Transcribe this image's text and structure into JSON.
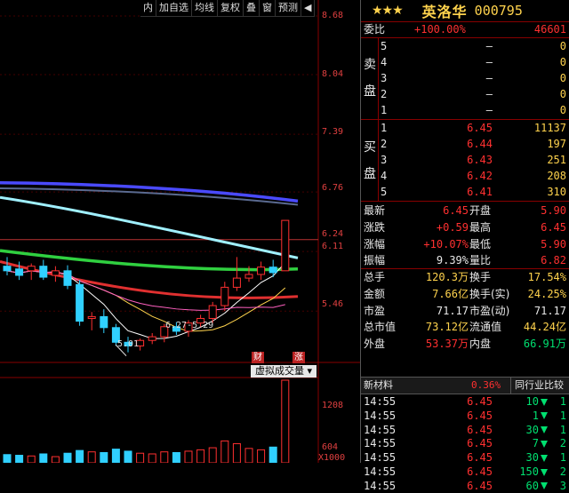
{
  "toolbar": {
    "items": [
      "内",
      "加自选",
      "均线",
      "复权",
      "叠",
      "窗",
      "预测",
      "◀"
    ]
  },
  "price_axis": {
    "ticks": [
      "8.68",
      "8.04",
      "7.39",
      "6.76",
      "6.24",
      "6.11",
      "5.46"
    ]
  },
  "volume_axis": {
    "ticks": [
      "1208",
      "604",
      "X1000"
    ]
  },
  "annotations": {
    "low": "5.01",
    "range": "6.27-5.29"
  },
  "badges": {
    "cai": "财",
    "zhang": "涨"
  },
  "volume_panel": {
    "label": "虚拟成交量"
  },
  "stock": {
    "stars": "★★★",
    "name": "英洛华",
    "code": "000795"
  },
  "weibi": {
    "label": "委比",
    "pct": "+100.00%",
    "diff": "46601"
  },
  "sell": {
    "label_top": "卖",
    "label_bottom": "盘",
    "levels": [
      {
        "n": "5",
        "p": "–",
        "v": "0"
      },
      {
        "n": "4",
        "p": "–",
        "v": "0"
      },
      {
        "n": "3",
        "p": "–",
        "v": "0"
      },
      {
        "n": "2",
        "p": "–",
        "v": "0"
      },
      {
        "n": "1",
        "p": "–",
        "v": "0"
      }
    ]
  },
  "buy": {
    "label_top": "买",
    "label_bottom": "盘",
    "levels": [
      {
        "n": "1",
        "p": "6.45",
        "v": "11137"
      },
      {
        "n": "2",
        "p": "6.44",
        "v": "197"
      },
      {
        "n": "3",
        "p": "6.43",
        "v": "251"
      },
      {
        "n": "4",
        "p": "6.42",
        "v": "208"
      },
      {
        "n": "5",
        "p": "6.41",
        "v": "310"
      }
    ]
  },
  "quote": [
    {
      "l1": "最新",
      "v1": "6.45",
      "l2": "开盘",
      "v2": "5.90",
      "c1": "red",
      "c2": "red"
    },
    {
      "l1": "涨跌",
      "v1": "+0.59",
      "l2": "最高",
      "v2": "6.45",
      "c1": "red",
      "c2": "red"
    },
    {
      "l1": "涨幅",
      "v1": "+10.07%",
      "l2": "最低",
      "v2": "5.90",
      "c1": "red",
      "c2": "red"
    },
    {
      "l1": "振幅",
      "v1": "9.39%",
      "l2": "量比",
      "v2": "6.82",
      "c1": "wht",
      "c2": "red"
    }
  ],
  "stats": [
    {
      "l1": "总手",
      "v1": "120.3万",
      "l2": "换手",
      "v2": "17.54%",
      "c1": "yel",
      "c2": "yel"
    },
    {
      "l1": "金额",
      "v1": "7.66亿",
      "l2": "换手(实)",
      "v2": "24.25%",
      "c1": "yel",
      "c2": "yel"
    },
    {
      "l1": "市盈",
      "v1": "71.17",
      "l2": "市盈(动)",
      "v2": "71.17",
      "c1": "wht",
      "c2": "wht"
    },
    {
      "l1": "总市值",
      "v1": "73.12亿",
      "l2": "流通值",
      "v2": "44.24亿",
      "c1": "yel",
      "c2": "yel"
    },
    {
      "l1": "外盘",
      "v1": "53.37万",
      "l2": "内盘",
      "v2": "66.91万",
      "c1": "red",
      "c2": "grn"
    }
  ],
  "sector": {
    "name": "新材料",
    "pct": "0.36%",
    "compare": "同行业比较"
  },
  "ticks": [
    {
      "t": "14:55",
      "p": "6.45",
      "v": "10",
      "n": "1"
    },
    {
      "t": "14:55",
      "p": "6.45",
      "v": "1",
      "n": "1"
    },
    {
      "t": "14:55",
      "p": "6.45",
      "v": "30",
      "n": "1"
    },
    {
      "t": "14:55",
      "p": "6.45",
      "v": "7",
      "n": "2"
    },
    {
      "t": "14:55",
      "p": "6.45",
      "v": "30",
      "n": "1"
    },
    {
      "t": "14:55",
      "p": "6.45",
      "v": "150",
      "n": "2"
    },
    {
      "t": "14:55",
      "p": "6.45",
      "v": "60",
      "n": "3"
    }
  ],
  "colors": {
    "up": "#ff3030",
    "down": "#00e070",
    "gold": "#ffd34d",
    "grid": "#800000"
  },
  "chart_data": {
    "type": "candlestick",
    "ylim": [
      4.9,
      8.68
    ],
    "candles": [
      {
        "o": 5.95,
        "h": 6.05,
        "l": 5.85,
        "c": 5.9
      },
      {
        "o": 5.92,
        "h": 6.0,
        "l": 5.8,
        "c": 5.85
      },
      {
        "o": 5.9,
        "h": 5.98,
        "l": 5.8,
        "c": 5.95
      },
      {
        "o": 5.95,
        "h": 6.02,
        "l": 5.8,
        "c": 5.83
      },
      {
        "o": 5.85,
        "h": 5.95,
        "l": 5.78,
        "c": 5.9
      },
      {
        "o": 5.9,
        "h": 5.96,
        "l": 5.7,
        "c": 5.74
      },
      {
        "o": 5.75,
        "h": 5.8,
        "l": 5.3,
        "c": 5.35
      },
      {
        "o": 5.38,
        "h": 5.45,
        "l": 5.25,
        "c": 5.4
      },
      {
        "o": 5.4,
        "h": 5.48,
        "l": 5.22,
        "c": 5.28
      },
      {
        "o": 5.28,
        "h": 5.32,
        "l": 5.08,
        "c": 5.12
      },
      {
        "o": 5.12,
        "h": 5.18,
        "l": 5.01,
        "c": 5.08
      },
      {
        "o": 5.08,
        "h": 5.16,
        "l": 5.03,
        "c": 5.14
      },
      {
        "o": 5.14,
        "h": 5.22,
        "l": 5.1,
        "c": 5.18
      },
      {
        "o": 5.18,
        "h": 5.32,
        "l": 5.12,
        "c": 5.29
      },
      {
        "o": 5.29,
        "h": 5.34,
        "l": 5.2,
        "c": 5.24
      },
      {
        "o": 5.24,
        "h": 5.36,
        "l": 5.18,
        "c": 5.33
      },
      {
        "o": 5.33,
        "h": 5.42,
        "l": 5.28,
        "c": 5.38
      },
      {
        "o": 5.38,
        "h": 5.56,
        "l": 5.33,
        "c": 5.52
      },
      {
        "o": 5.52,
        "h": 5.78,
        "l": 5.46,
        "c": 5.72
      },
      {
        "o": 5.72,
        "h": 6.05,
        "l": 5.68,
        "c": 5.82
      },
      {
        "o": 5.82,
        "h": 5.95,
        "l": 5.78,
        "c": 5.86
      },
      {
        "o": 5.86,
        "h": 6.0,
        "l": 5.8,
        "c": 5.94
      },
      {
        "o": 5.94,
        "h": 6.02,
        "l": 5.83,
        "c": 5.88
      },
      {
        "o": 5.9,
        "h": 6.45,
        "l": 5.9,
        "c": 6.45
      }
    ],
    "volumes": [
      120,
      110,
      100,
      130,
      90,
      140,
      180,
      160,
      150,
      200,
      170,
      140,
      130,
      160,
      150,
      170,
      190,
      220,
      320,
      280,
      210,
      190,
      230,
      1208
    ]
  }
}
